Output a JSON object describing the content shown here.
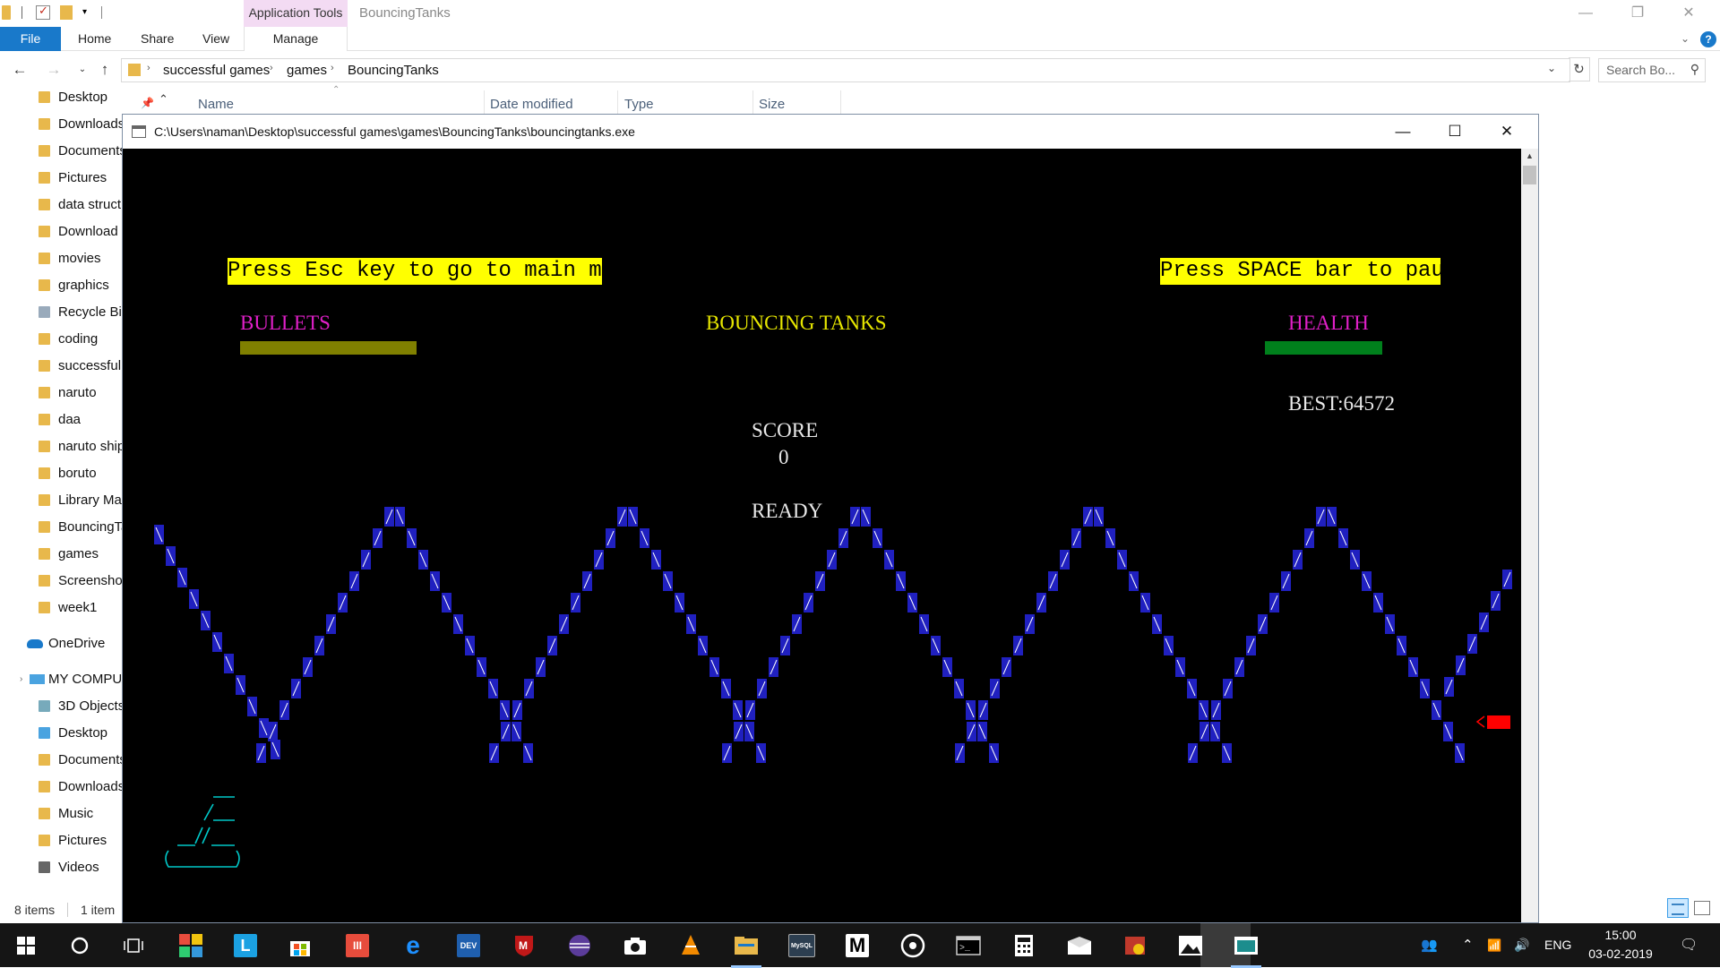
{
  "explorer": {
    "window_title": "BouncingTanks",
    "contextual_tab_header": "Application Tools",
    "controls": {
      "minimize": "—",
      "restore": "❐",
      "close": "✕"
    },
    "ribbon": {
      "file": "File",
      "tabs": [
        "Home",
        "Share",
        "View"
      ],
      "manage": "Manage",
      "expand": "⌄",
      "help": "?"
    },
    "nav_buttons": {
      "back": "←",
      "forward": "→",
      "recent": "⌄",
      "up": "↑"
    },
    "address": {
      "crumbs": [
        "successful games",
        "games",
        "BouncingTanks"
      ],
      "separator": "›",
      "dropdown": "⌄",
      "refresh": "↻"
    },
    "search": {
      "placeholder": "Search Bo...",
      "icon": "⚲"
    },
    "nav_pane": {
      "quick_access": [
        "Desktop",
        "Downloads",
        "Documents",
        "Pictures",
        "data struct",
        "Download",
        "movies",
        "graphics",
        "Recycle Bin",
        "coding",
        "successful games",
        "naruto",
        "daa",
        "naruto ship",
        "boruto",
        "Library Ma",
        "BouncingTa",
        "games",
        "Screenshot",
        "week1"
      ],
      "onedrive": "OneDrive",
      "my_computer": "MY COMPUTER",
      "pc_items": [
        "3D Objects",
        "Desktop",
        "Documents",
        "Downloads",
        "Music",
        "Pictures",
        "Videos"
      ],
      "expand_arrow": "›"
    },
    "columns": {
      "name": "Name",
      "date_modified": "Date modified",
      "type": "Type",
      "size": "Size",
      "pin": "📌",
      "collapse": "⌃",
      "sort": "⌃"
    },
    "status": {
      "items": "8 items",
      "selected": "1 item"
    }
  },
  "console": {
    "title": "C:\\Users\\naman\\Desktop\\successful games\\games\\BouncingTanks\\bouncingtanks.exe",
    "controls": {
      "minimize": "—",
      "maximize": "☐",
      "close": "✕"
    },
    "scroll_up": "▲"
  },
  "game": {
    "esc_hint": "Press Esc key to go to main menu",
    "pause_hint": "Press SPACE bar to pause",
    "bullets_label": "BULLETS",
    "title": "BOUNCING TANKS",
    "health_label": "HEALTH",
    "best": "BEST:64572",
    "score_label": "SCORE",
    "score_value": "0",
    "status": "READY",
    "bullets_level": 1.0,
    "health_level": 1.0,
    "colors": {
      "terrain": "#2020c0",
      "terrain_glyph": "#ffffff",
      "player_tank": "#00c8c8",
      "enemy_tank": "#ff0000",
      "banner": "#ffff00",
      "magenta": "#e020c8",
      "title": "#e6e600",
      "bullets_bar": "#808000",
      "health_bar": "#00801c"
    }
  },
  "taskbar": {
    "icons": [
      "windows-start",
      "cortana-search",
      "task-view",
      "microsoft-store-tiles",
      "l-app",
      "store",
      "office-app",
      "edge",
      "dev-cpp",
      "mcafee",
      "eclipse",
      "camera",
      "vlc",
      "file-explorer",
      "mysql",
      "mingw",
      "chrome-like",
      "console",
      "calculator",
      "mail",
      "security-app",
      "photos",
      "active-console"
    ],
    "tray": {
      "people": "👥",
      "chevron": "⌃",
      "network": "📶",
      "volume": "🔊",
      "language": "ENG",
      "notifications": "🗨"
    },
    "time": "15:00",
    "date": "03-02-2019"
  }
}
